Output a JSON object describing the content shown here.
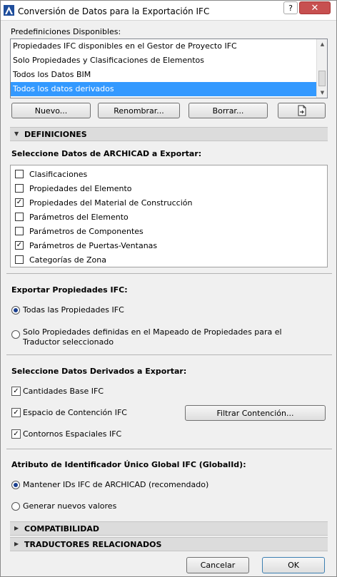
{
  "window": {
    "title": "Conversión de Datos para la Exportación IFC",
    "help_label": "?",
    "close_label": "✕"
  },
  "presets": {
    "label": "Predefiniciones Disponibles:",
    "items": [
      "Propiedades IFC disponibles en el Gestor de Proyecto IFC",
      "Solo Propiedades y Clasificaciones de Elementos",
      "Todos los Datos BIM",
      "Todos los datos derivados"
    ],
    "selected_index": 3
  },
  "preset_buttons": {
    "new": "Nuevo...",
    "rename": "Renombrar...",
    "delete": "Borrar..."
  },
  "definitions": {
    "section_title": "DEFINICIONES",
    "data_label": "Seleccione Datos de ARCHICAD a Exportar:",
    "data_items": [
      {
        "label": "Clasificaciones",
        "checked": false
      },
      {
        "label": "Propiedades del Elemento",
        "checked": false
      },
      {
        "label": "Propiedades del Material de Construcción",
        "checked": true
      },
      {
        "label": "Parámetros del Elemento",
        "checked": false
      },
      {
        "label": "Parámetros de Componentes",
        "checked": false
      },
      {
        "label": "Parámetros de Puertas-Ventanas",
        "checked": true
      },
      {
        "label": "Categorías de Zona",
        "checked": false
      }
    ],
    "export_props_label": "Exportar Propiedades IFC:",
    "export_props_options": [
      {
        "label": "Todas las Propiedades IFC",
        "selected": true
      },
      {
        "label": "Solo Propiedades definidas en el Mapeado de Propiedades para el Traductor seleccionado",
        "selected": false
      }
    ],
    "derived_label": "Seleccione Datos Derivados a Exportar:",
    "derived_items": [
      {
        "label": "Cantidades Base IFC",
        "checked": true
      },
      {
        "label": "Espacio de Contención IFC",
        "checked": true
      },
      {
        "label": "Contornos Espaciales IFC",
        "checked": true
      }
    ],
    "filter_button": "Filtrar Contención...",
    "globalid_label": "Atributo de Identificador Único Global IFC (GlobalId):",
    "globalid_options": [
      {
        "label": "Mantener IDs IFC de ARCHICAD (recomendado)",
        "selected": true
      },
      {
        "label": "Generar nuevos valores",
        "selected": false
      }
    ]
  },
  "compatibility": {
    "section_title": "COMPATIBILIDAD"
  },
  "translators": {
    "section_title": "TRADUCTORES RELACIONADOS"
  },
  "footer": {
    "cancel": "Cancelar",
    "ok": "OK"
  },
  "colors": {
    "selection": "#3399ff",
    "close": "#c75050"
  }
}
